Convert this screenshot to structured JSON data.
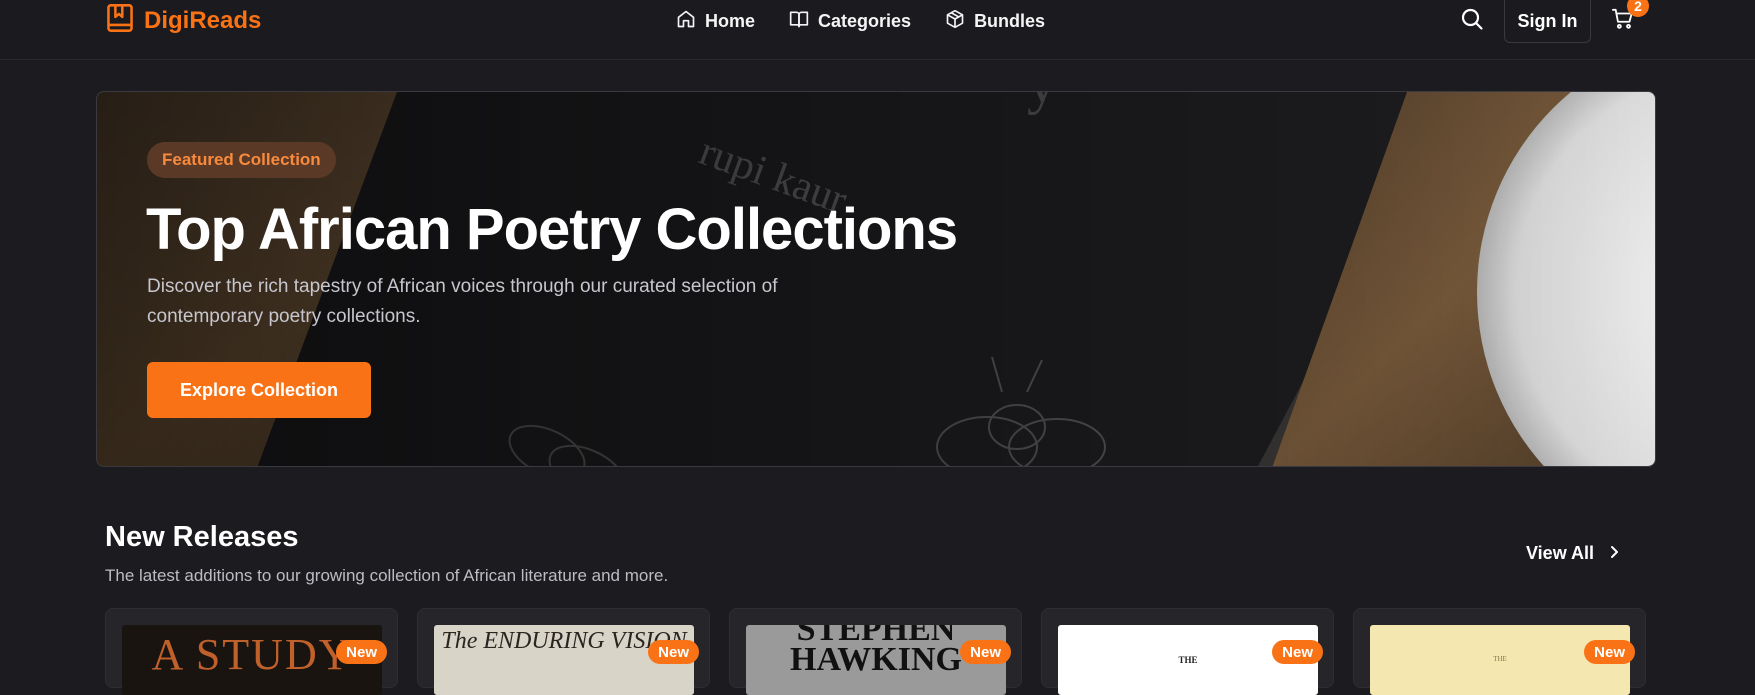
{
  "brand": {
    "name": "DigiReads",
    "icon": "book-bookmark-icon",
    "accent": "#f97316"
  },
  "nav": {
    "items": [
      {
        "label": "Home",
        "icon": "home-icon"
      },
      {
        "label": "Categories",
        "icon": "open-book-icon"
      },
      {
        "label": "Bundles",
        "icon": "package-icon"
      }
    ],
    "sign_in_label": "Sign In",
    "cart_count": "2"
  },
  "hero": {
    "badge": "Featured Collection",
    "title": "Top African Poetry Collections",
    "description": "Discover the rich tapestry of African voices through our curated selection of contemporary poetry collections.",
    "cta_label": "Explore Collection",
    "background_text": "rupi kaur"
  },
  "new_releases": {
    "title": "New Releases",
    "subtitle": "The latest additions to our growing collection of African literature and more.",
    "view_all_label": "View All",
    "books": [
      {
        "badge": "New",
        "cover_text": "A STUDY",
        "cover_color": "#1a1410",
        "text_color": "#c0602a"
      },
      {
        "badge": "New",
        "cover_text": "The ENDURING VISION",
        "cover_color": "#d9d4c8",
        "text_color": "#2a2520"
      },
      {
        "badge": "New",
        "cover_text": "STEPHEN HAWKING",
        "cover_color": "#9a9a9a",
        "text_color": "#111111"
      },
      {
        "badge": "New",
        "cover_text": "THE",
        "cover_color": "#ffffff",
        "text_color": "#222222"
      },
      {
        "badge": "New",
        "cover_text": "THE",
        "cover_color": "#f5e7b0",
        "text_color": "#8a7a50"
      }
    ]
  }
}
